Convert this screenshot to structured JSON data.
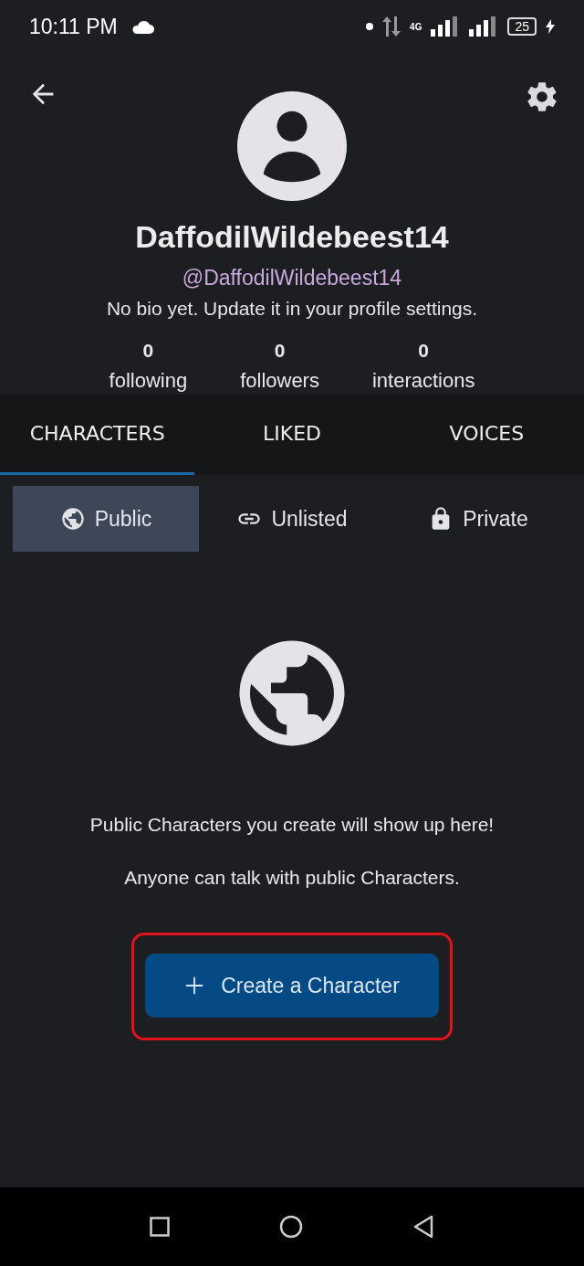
{
  "status_bar": {
    "time": "10:11 PM",
    "network": "4G",
    "battery": "25"
  },
  "profile": {
    "name": "DaffodilWildebeest14",
    "handle": "@DaffodilWildebeest14",
    "bio": "No bio yet. Update it in your profile settings.",
    "stats": [
      {
        "value": "0",
        "label": "following"
      },
      {
        "value": "0",
        "label": "followers"
      },
      {
        "value": "0",
        "label": "interactions"
      }
    ]
  },
  "tabs": [
    {
      "label": "CHARACTERS",
      "selected": true
    },
    {
      "label": "LIKED",
      "selected": false
    },
    {
      "label": "VOICES",
      "selected": false
    }
  ],
  "visibility_tabs": [
    {
      "kind": "public",
      "label": "Public",
      "selected": true
    },
    {
      "kind": "unlisted",
      "label": "Unlisted",
      "selected": false
    },
    {
      "kind": "private",
      "label": "Private",
      "selected": false
    }
  ],
  "empty_state": {
    "message": "Public Characters you create will show up here!",
    "note": "Anyone can talk with public Characters."
  },
  "create_button": {
    "label": "Create a Character",
    "highlighted": true
  }
}
